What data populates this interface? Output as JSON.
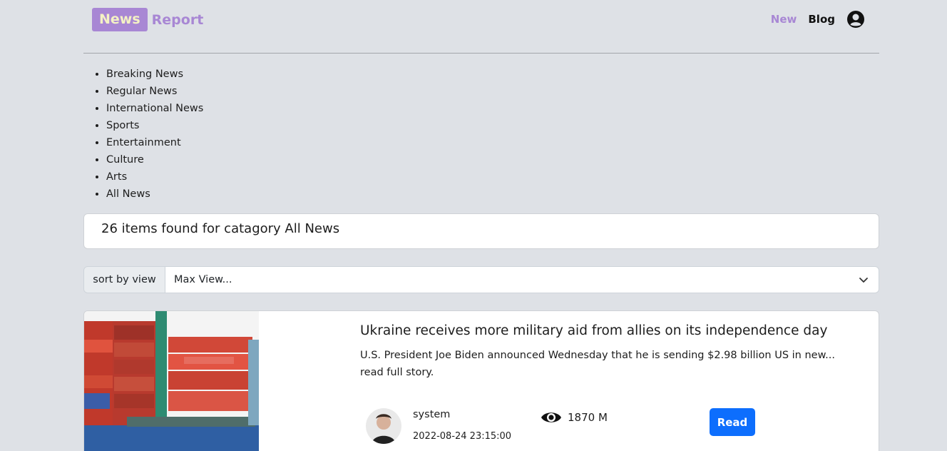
{
  "header": {
    "logo_box": "News",
    "logo_text": "Report",
    "nav_new": "New",
    "nav_blog": "Blog"
  },
  "categories": [
    "Breaking News",
    "Regular News",
    "International News",
    "Sports",
    "Entertainment",
    "Culture",
    "Arts",
    "All News"
  ],
  "results": {
    "found_text": "26 items found for catagory All News"
  },
  "sort": {
    "label": "sort by view",
    "selected": "Max View..."
  },
  "article": {
    "title": "Ukraine receives more military aid from allies on its independence day",
    "description": "U.S. President Joe Biden announced Wednesday that he is sending $2.98 billion US in new... read full story.",
    "author": "system",
    "date": "2022-08-24 23:15:00",
    "views": "1870 M",
    "read_label": "Read"
  },
  "colors": {
    "brand": "#a887d4",
    "accent_button": "#0d6efd",
    "background": "#dee1e6"
  },
  "icons": [
    "user-circle-icon",
    "chevron-down-icon",
    "eye-icon"
  ]
}
